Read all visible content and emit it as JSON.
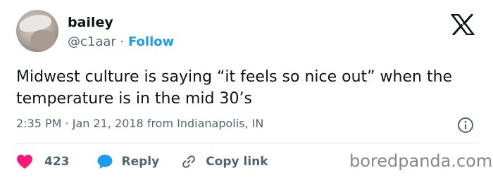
{
  "author": {
    "display_name": "bailey",
    "handle": "@c1aar",
    "separator": " · ",
    "follow_label": "Follow"
  },
  "tweet": {
    "text": "Midwest culture is saying “it feels so nice out” when the temperature is in the mid 30’s",
    "time": "2:35 PM",
    "meta_separator": " · ",
    "date": "Jan 21, 2018",
    "location": " from Indianapolis, IN"
  },
  "actions": {
    "like_count": "423",
    "reply_label": "Reply",
    "copy_label": "Copy link"
  },
  "watermark": "boredpanda.com",
  "icons": {
    "platform": "x-logo-icon",
    "info": "info-icon",
    "like": "heart-icon",
    "reply": "speech-bubble-icon",
    "copy": "link-icon"
  },
  "colors": {
    "accent": "#1d9bf0",
    "like": "#f91880",
    "text": "#0f1419",
    "secondary": "#536471",
    "watermark": "#888888"
  }
}
